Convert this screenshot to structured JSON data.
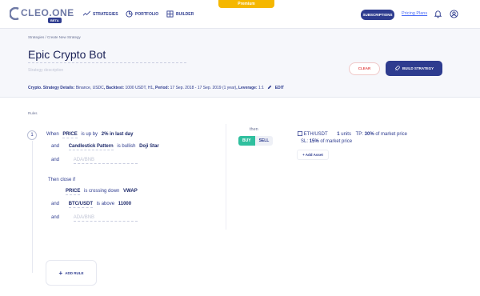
{
  "premium": "Premium",
  "logo": {
    "text": "CLEO.ONE",
    "badge": "BETA"
  },
  "nav": {
    "strategies": "STRATEGIES",
    "portfolio": "PORTFOLIO",
    "builder": "BUILDER"
  },
  "header": {
    "subscriptions": "SUBSCRIPTIONS",
    "pricing": "Pricing Plans"
  },
  "breadcrumb": "Strategies  /  Create New Strategy",
  "strategy": {
    "title": "Epic Crypto Bot",
    "description_placeholder": "Strategy description",
    "info_kind": "Crypto",
    "details_label": "Strategy Details:",
    "details_value": "Binance, USDC",
    "backtest_label": "Backtest:",
    "backtest_value": "1000 USDT, H1",
    "period_label": "Period:",
    "period_value": "17 Sep. 2018 - 17 Sep. 2019 (1 year)",
    "leverage_label": "Leverage:",
    "leverage_value": "1:1",
    "edit": "EDIT"
  },
  "actions": {
    "clear": "CLEAR",
    "build": "BUILD STRATEGY"
  },
  "rules_label": "Rules",
  "rule": {
    "number": "1",
    "when": "When",
    "c1_field": "PRICE",
    "c1_op": "is up by",
    "c1_value": "2% in last day",
    "and": "and",
    "c2_field": "Candlestick Pattern",
    "c2_op": "is bullish",
    "c2_value": "Doji Star",
    "add_placeholder": "ADA/BNB",
    "then_close": "Then close if",
    "x1_field": "PRICE",
    "x1_op": "is crossing down",
    "x1_value": "VWAP",
    "x2_field": "BTC/USDT",
    "x2_op": "is above",
    "x2_value": "11000"
  },
  "action": {
    "then": "then",
    "buy": "BUY",
    "sell": "SELL",
    "asset": "ETH/USDT",
    "units": "1",
    "units_label": "units",
    "tp_label": "TP:",
    "tp_value": "30%",
    "tp_suffix": "of market price",
    "sl_label": "SL:",
    "sl_value": "15%",
    "sl_suffix": "of market price",
    "add_asset": "+ Add Asset"
  },
  "add_rule": "ADD RULE",
  "colors": {
    "primary": "#2e3c8f",
    "buy": "#2fbf9e",
    "clear": "#e24b4b",
    "premium": "#f5b700"
  }
}
